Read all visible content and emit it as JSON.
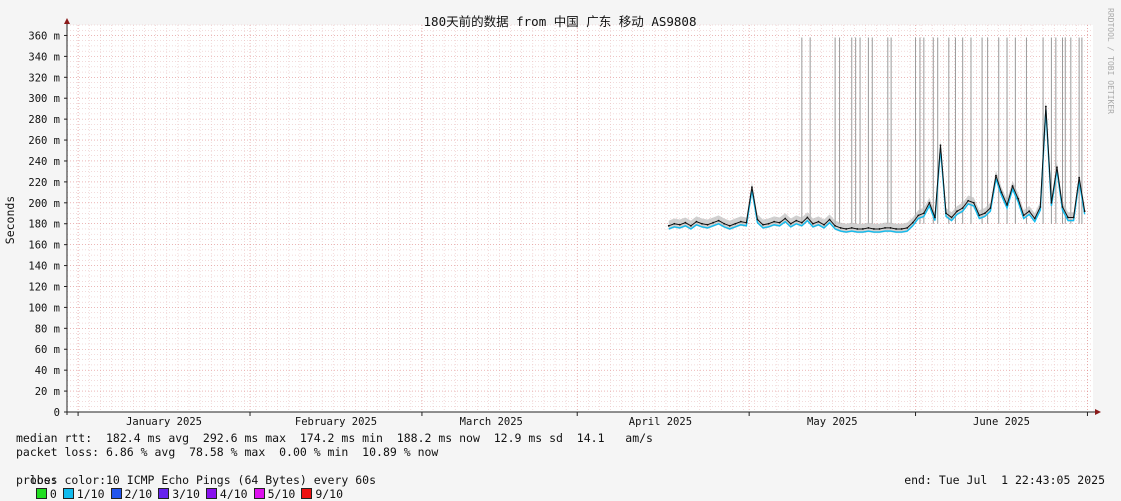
{
  "chart_data": {
    "type": "line",
    "title": "180天前的数据 from 中国 广东 移动 AS9808",
    "ylabel": "Seconds",
    "watermark": "RRDTOOL / TOBI OETIKER",
    "ylim_ms": [
      0,
      370
    ],
    "y_ticks": [
      {
        "v": 0,
        "label": "0"
      },
      {
        "v": 20,
        "label": "20 m"
      },
      {
        "v": 40,
        "label": "40 m"
      },
      {
        "v": 60,
        "label": "60 m"
      },
      {
        "v": 80,
        "label": "80 m"
      },
      {
        "v": 100,
        "label": "100 m"
      },
      {
        "v": 120,
        "label": "120 m"
      },
      {
        "v": 140,
        "label": "140 m"
      },
      {
        "v": 160,
        "label": "160 m"
      },
      {
        "v": 180,
        "label": "180 m"
      },
      {
        "v": 200,
        "label": "200 m"
      },
      {
        "v": 220,
        "label": "220 m"
      },
      {
        "v": 240,
        "label": "240 m"
      },
      {
        "v": 260,
        "label": "260 m"
      },
      {
        "v": 280,
        "label": "280 m"
      },
      {
        "v": 300,
        "label": "300 m"
      },
      {
        "v": 320,
        "label": "320 m"
      },
      {
        "v": 340,
        "label": "340 m"
      },
      {
        "v": 360,
        "label": "360 m"
      }
    ],
    "x_range_days": [
      0,
      185
    ],
    "x_ticks": [
      {
        "day": 17.5,
        "label": "January 2025"
      },
      {
        "day": 48.5,
        "label": "February 2025"
      },
      {
        "day": 76.5,
        "label": "March 2025"
      },
      {
        "day": 107.0,
        "label": "April 2025"
      },
      {
        "day": 138.0,
        "label": "May 2025"
      },
      {
        "day": 168.5,
        "label": "June 2025"
      }
    ],
    "month_starts_day": [
      2,
      33,
      64,
      92,
      123,
      153,
      184
    ],
    "series": [
      {
        "name": "median rtt",
        "color": "#111111",
        "x_day": [
          108.5,
          109.5,
          110.5,
          111.5,
          112.5,
          113.5,
          114.5,
          115.5,
          116.5,
          117.5,
          118.5,
          119.5,
          120.5,
          121.5,
          122.5,
          123.5,
          124.5,
          125.5,
          126.5,
          127.5,
          128.5,
          129.5,
          130.5,
          131.5,
          132.5,
          133.5,
          134.5,
          135.5,
          136.5,
          137.5,
          138.5,
          139.5,
          140.5,
          141.5,
          142.5,
          143.5,
          144.5,
          145.5,
          146.5,
          147.5,
          148.5,
          149.5,
          150.5,
          151.5,
          152.5,
          153.5,
          154.5,
          155.5,
          156.5,
          157.5,
          158.5,
          159.5,
          160.5,
          161.5,
          162.5,
          163.5,
          164.5,
          165.5,
          166.5,
          167.5,
          168.5,
          169.5,
          170.5,
          171.5,
          172.5,
          173.5,
          174.5,
          175.5,
          176.5,
          177.5,
          178.5,
          179.5,
          180.5,
          181.5,
          182.5,
          183.5
        ],
        "y_ms": [
          178,
          180,
          179,
          181,
          178,
          182,
          180,
          179,
          181,
          183,
          180,
          178,
          180,
          182,
          181,
          215,
          184,
          179,
          180,
          182,
          181,
          185,
          180,
          183,
          181,
          186,
          180,
          182,
          179,
          184,
          178,
          176,
          175,
          176,
          175,
          175,
          176,
          175,
          175,
          176,
          176,
          175,
          175,
          176,
          181,
          188,
          190,
          200,
          186,
          255,
          190,
          186,
          192,
          195,
          202,
          200,
          188,
          190,
          195,
          226,
          210,
          198,
          216,
          204,
          188,
          192,
          185,
          196,
          292,
          200,
          234,
          196,
          186,
          186,
          224,
          192
        ]
      }
    ],
    "loss_spikes_day": [
      132.5,
      134.0,
      138.5,
      139.3,
      141.5,
      142.2,
      143.0,
      144.5,
      145.2,
      148.0,
      148.6,
      153.0,
      153.8,
      154.5,
      156.2,
      157.0,
      159.0,
      160.2,
      161.5,
      163.0,
      165.0,
      166.0,
      168.0,
      169.5,
      171.0,
      173.0,
      176.0,
      177.5,
      178.3,
      179.5,
      180.0,
      181.0,
      182.5,
      183.0
    ],
    "stats": {
      "median_rtt": "median rtt:  182.4 ms avg  292.6 ms max  174.2 ms min  188.2 ms now  12.9 ms sd  14.1   am/s",
      "packet_loss": "packet loss: 6.86 % avg  78.58 % max  0.00 % min  10.89 % now",
      "loss_color_label": "loss color:",
      "loss_colors": [
        {
          "label": "0",
          "color": "#22dd22"
        },
        {
          "label": "1/10",
          "color": "#11bbee"
        },
        {
          "label": "2/10",
          "color": "#2255ee"
        },
        {
          "label": "3/10",
          "color": "#6622ee"
        },
        {
          "label": "4/10",
          "color": "#8811ee"
        },
        {
          "label": "5/10",
          "color": "#dd11ee"
        },
        {
          "label": "9/10",
          "color": "#ee1111"
        }
      ],
      "probe": "probe:       10 ICMP Echo Pings (64 Bytes) every 60s",
      "end": "end: Tue Jul  1 22:43:05 2025"
    }
  }
}
